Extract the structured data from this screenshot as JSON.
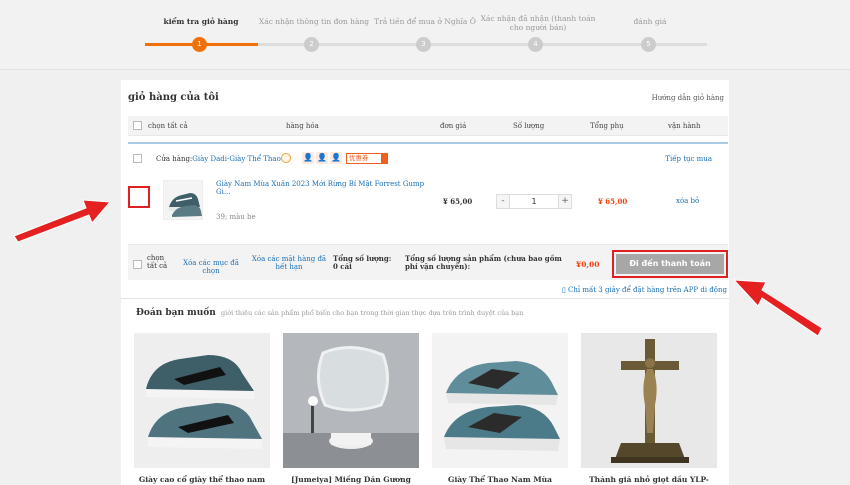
{
  "steps": [
    {
      "label": "kiểm tra giỏ hàng",
      "num": "1",
      "active": true
    },
    {
      "label": "Xác nhận thông tin đơn hàng",
      "num": "2"
    },
    {
      "label": "Trả tiền để mua ở Nghĩa Ô",
      "num": "3"
    },
    {
      "label": "Xác nhận đã nhận (thanh toán cho người bán)",
      "num": "4"
    },
    {
      "label": "đánh giá",
      "num": "5"
    }
  ],
  "cart": {
    "title": "giỏ hàng của tôi",
    "guide": "Hướng dẫn giỏ hàng",
    "headers": {
      "select_all": "chọn tất cả",
      "item": "hàng hóa",
      "unit_price": "đơn giá",
      "quantity": "Số lượng",
      "subtotal": "Tổng phụ",
      "operation": "vận hành"
    },
    "shop": {
      "prefix": "Cửa hàng:",
      "name": "Giày Dadi-Giày Thể Thao",
      "coupon": "优惠券",
      "continue": "Tiếp tục mua"
    },
    "product": {
      "name": "Giày Nam Mùa Xuân 2023 Mới Rừng Bí Mật Forrest Gump Gi...",
      "variant": "39; màu be",
      "price": "¥ 65,00",
      "qty": "1",
      "minus": "-",
      "plus": "+",
      "subtotal": "¥ 65,00",
      "delete": "xóa bỏ"
    },
    "footer": {
      "select_all": "chọn tất cả",
      "delete_selected": "Xóa các mục đã chọn",
      "delete_sold_out": "Xóa các mặt hàng đã hết hạn",
      "total_qty": "Tổng số lượng: 0 cái",
      "total_label": "Tổng số lượng sản phẩm (chưa bao gồm phí vận chuyển):",
      "total_value": "¥0,00",
      "checkout": "Đi đến thanh toán"
    },
    "app_note": "Chỉ mất 3 giây để đặt hàng trên APP di động"
  },
  "reco": {
    "title": "Đoán bạn muốn",
    "subtitle": "giới thiệu các sản phẩm phổ biến cho bạn trong thời gian thực dựa trên trình duyệt của bạn",
    "items": [
      {
        "name": "Giày cao cổ giày thể thao nam"
      },
      {
        "name": "[Jumeiya] Miếng Dán Gương"
      },
      {
        "name": "Giày Thể Thao Nam Mùa"
      },
      {
        "name": "Thánh giá nhỏ giọt dầu YLP-"
      }
    ]
  },
  "colors": {
    "accent": "#f0710a",
    "annotation": "#e02020",
    "link": "#1a6fb5"
  }
}
